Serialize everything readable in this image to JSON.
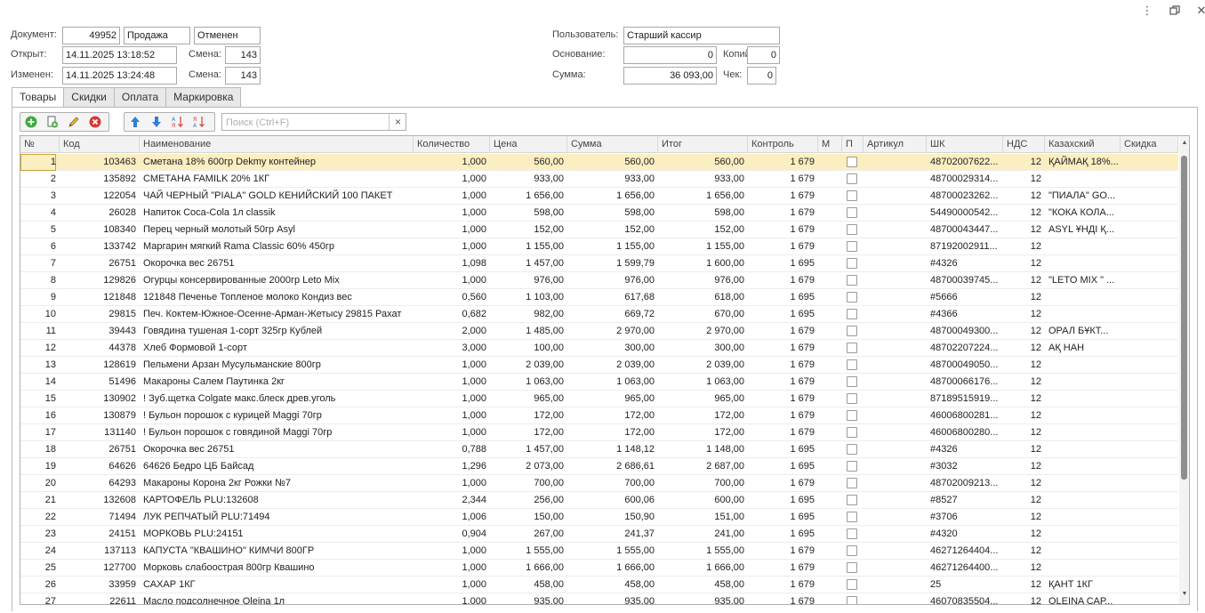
{
  "window": {
    "menu_icon": "more-vert-icon",
    "restore_icon": "restore-icon",
    "close_icon": "close-icon"
  },
  "doc": {
    "label_document": "Документ:",
    "number": "49952",
    "type": "Продажа",
    "status": "Отменен",
    "label_opened": "Открыт:",
    "opened": "14.11.2025 13:18:52",
    "label_shift1": "Смена:",
    "shift1": "143",
    "label_changed": "Изменен:",
    "changed": "14.11.2025 13:24:48",
    "label_shift2": "Смена:",
    "shift2": "143",
    "label_user": "Пользователь:",
    "user": "Старший кассир",
    "label_basis": "Основание:",
    "basis": "0",
    "label_copies": "Копий:",
    "copies": "0",
    "label_sum": "Сумма:",
    "sum": "36 093,00",
    "label_check": "Чек:",
    "check": "0"
  },
  "tabs": [
    "Товары",
    "Скидки",
    "Оплата",
    "Маркировка"
  ],
  "toolbar": {
    "icons": [
      "add-icon",
      "copy-icon",
      "edit-icon",
      "delete-icon",
      "move-up-icon",
      "move-down-icon",
      "sort-asc-icon",
      "sort-desc-icon"
    ],
    "search_placeholder": "Поиск (Ctrl+F)",
    "search_clear": "×"
  },
  "columns": [
    "№",
    "Код",
    "Наименование",
    "Количество",
    "Цена",
    "Сумма",
    "Итог",
    "Контроль",
    "М",
    "П",
    "Артикул",
    "ШК",
    "НДС",
    "Казахский",
    "Скидка"
  ],
  "rows": [
    [
      "1",
      "103463",
      "Сметана 18% 600гр Dekmy контейнер",
      "1,000",
      "560,00",
      "560,00",
      "560,00",
      "1 679",
      "",
      "",
      "",
      "48702007622...",
      "12",
      "ҚАЙМАҚ 18%...",
      ""
    ],
    [
      "2",
      "135892",
      "СМЕТАНА FAMILK 20% 1КГ",
      "1,000",
      "933,00",
      "933,00",
      "933,00",
      "1 679",
      "",
      "",
      "",
      "48700029314...",
      "12",
      "",
      ""
    ],
    [
      "3",
      "122054",
      "ЧАЙ ЧЕРНЫЙ \"PIALA\" GOLD КЕНИЙСКИЙ 100 ПАКЕТ",
      "1,000",
      "1 656,00",
      "1 656,00",
      "1 656,00",
      "1 679",
      "",
      "",
      "",
      "48700023262...",
      "12",
      "\"ПИАЛА\" GO...",
      ""
    ],
    [
      "4",
      "26028",
      "Напиток Coca-Cola 1л classik",
      "1,000",
      "598,00",
      "598,00",
      "598,00",
      "1 679",
      "",
      "",
      "",
      "54490000542...",
      "12",
      "\"КОКА КОЛА...",
      ""
    ],
    [
      "5",
      "108340",
      "Перец черный молотый 50гр Asyl",
      "1,000",
      "152,00",
      "152,00",
      "152,00",
      "1 679",
      "",
      "",
      "",
      "48700043447...",
      "12",
      "ASYL ҰНДІ Қ...",
      ""
    ],
    [
      "6",
      "133742",
      "Маргарин мягкий Rama Classic 60% 450гр",
      "1,000",
      "1 155,00",
      "1 155,00",
      "1 155,00",
      "1 679",
      "",
      "",
      "",
      "87192002911...",
      "12",
      "",
      ""
    ],
    [
      "7",
      "26751",
      "Окорочка вес 26751",
      "1,098",
      "1 457,00",
      "1 599,79",
      "1 600,00",
      "1 695",
      "",
      "",
      "",
      "#4326",
      "12",
      "",
      ""
    ],
    [
      "8",
      "129826",
      "Огурцы консервированные 2000гр Leto Mix",
      "1,000",
      "976,00",
      "976,00",
      "976,00",
      "1 679",
      "",
      "",
      "",
      "48700039745...",
      "12",
      "\"LETO MIX \" ...",
      ""
    ],
    [
      "9",
      "121848",
      "121848 Печенье Топленое молоко Кондиз вес",
      "0,560",
      "1 103,00",
      "617,68",
      "618,00",
      "1 695",
      "",
      "",
      "",
      "#5666",
      "12",
      "",
      ""
    ],
    [
      "10",
      "29815",
      "Печ. Коктем-Южное-Осенне-Арман-Жетысу 29815 Рахат",
      "0,682",
      "982,00",
      "669,72",
      "670,00",
      "1 695",
      "",
      "",
      "",
      "#4366",
      "12",
      "",
      ""
    ],
    [
      "11",
      "39443",
      "Говядина тушеная 1-сорт 325гр Кублей",
      "2,000",
      "1 485,00",
      "2 970,00",
      "2 970,00",
      "1 679",
      "",
      "",
      "",
      "48700049300...",
      "12",
      "ОРАЛ БҰКТ...",
      ""
    ],
    [
      "12",
      "44378",
      "Хлеб Формовой 1-сорт",
      "3,000",
      "100,00",
      "300,00",
      "300,00",
      "1 679",
      "",
      "",
      "",
      "48702207224...",
      "12",
      "АҚ НАН",
      ""
    ],
    [
      "13",
      "128619",
      "Пельмени Арзан Мусульманские 800гр",
      "1,000",
      "2 039,00",
      "2 039,00",
      "2 039,00",
      "1 679",
      "",
      "",
      "",
      "48700049050...",
      "12",
      "",
      ""
    ],
    [
      "14",
      "51496",
      "Макароны Салем Паутинка 2кг",
      "1,000",
      "1 063,00",
      "1 063,00",
      "1 063,00",
      "1 679",
      "",
      "",
      "",
      "48700066176...",
      "12",
      "",
      ""
    ],
    [
      "15",
      "130902",
      "! Зуб.щетка Colgate макс.блеск древ.уголь",
      "1,000",
      "965,00",
      "965,00",
      "965,00",
      "1 679",
      "",
      "",
      "",
      "87189515919...",
      "12",
      "",
      ""
    ],
    [
      "16",
      "130879",
      "! Бульон порошок с курицей Maggi 70гр",
      "1,000",
      "172,00",
      "172,00",
      "172,00",
      "1 679",
      "",
      "",
      "",
      "46006800281...",
      "12",
      "",
      ""
    ],
    [
      "17",
      "131140",
      "! Бульон порошок с говядиной Maggi 70гр",
      "1,000",
      "172,00",
      "172,00",
      "172,00",
      "1 679",
      "",
      "",
      "",
      "46006800280...",
      "12",
      "",
      ""
    ],
    [
      "18",
      "26751",
      "Окорочка вес 26751",
      "0,788",
      "1 457,00",
      "1 148,12",
      "1 148,00",
      "1 695",
      "",
      "",
      "",
      "#4326",
      "12",
      "",
      ""
    ],
    [
      "19",
      "64626",
      "64626 Бедро ЦБ Байсад",
      "1,296",
      "2 073,00",
      "2 686,61",
      "2 687,00",
      "1 695",
      "",
      "",
      "",
      "#3032",
      "12",
      "",
      ""
    ],
    [
      "20",
      "64293",
      "Макароны Корона 2кг Рожки №7",
      "1,000",
      "700,00",
      "700,00",
      "700,00",
      "1 679",
      "",
      "",
      "",
      "48702009213...",
      "12",
      "",
      ""
    ],
    [
      "21",
      "132608",
      "КАРТОФЕЛЬ PLU:132608",
      "2,344",
      "256,00",
      "600,06",
      "600,00",
      "1 695",
      "",
      "",
      "",
      "#8527",
      "12",
      "",
      ""
    ],
    [
      "22",
      "71494",
      "ЛУК РЕПЧАТЫЙ PLU:71494",
      "1,006",
      "150,00",
      "150,90",
      "151,00",
      "1 695",
      "",
      "",
      "",
      "#3706",
      "12",
      "",
      ""
    ],
    [
      "23",
      "24151",
      "МОРКОВЬ PLU:24151",
      "0,904",
      "267,00",
      "241,37",
      "241,00",
      "1 695",
      "",
      "",
      "",
      "#4320",
      "12",
      "",
      ""
    ],
    [
      "24",
      "137113",
      "КАПУСТА \"КВАШИНО\" КИМЧИ 800ГР",
      "1,000",
      "1 555,00",
      "1 555,00",
      "1 555,00",
      "1 679",
      "",
      "",
      "",
      "46271264404...",
      "12",
      "",
      ""
    ],
    [
      "25",
      "127700",
      "Морковь слабоострая 800гр Квашино",
      "1,000",
      "1 666,00",
      "1 666,00",
      "1 666,00",
      "1 679",
      "",
      "",
      "",
      "46271264400...",
      "12",
      "",
      ""
    ],
    [
      "26",
      "33959",
      "САХАР 1КГ",
      "1,000",
      "458,00",
      "458,00",
      "458,00",
      "1 679",
      "",
      "",
      "",
      "25",
      "12",
      "ҚАНТ 1КГ",
      ""
    ],
    [
      "27",
      "22611",
      "Масло подсолнечное Oleina 1л",
      "1,000",
      "935,00",
      "935,00",
      "935,00",
      "1 679",
      "",
      "",
      "",
      "46070835504...",
      "12",
      "OLEINA САР...",
      ""
    ]
  ]
}
